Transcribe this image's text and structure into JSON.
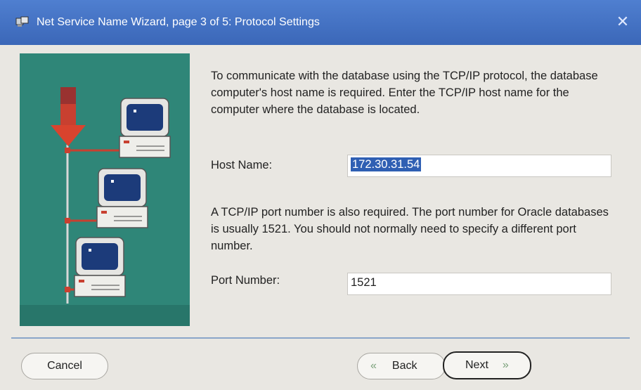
{
  "window": {
    "title": "Net Service Name Wizard, page 3 of 5: Protocol Settings",
    "close_glyph": "✕"
  },
  "content": {
    "intro": "To communicate with the database using the TCP/IP protocol, the database computer's host name is required.  Enter the TCP/IP host name for the computer where the database is located.",
    "host_label": "Host Name:",
    "host_value": "172.30.31.54",
    "port_intro": "A TCP/IP port number is also required.  The port number for Oracle databases is usually 1521.  You should not normally need to specify a different port number.",
    "port_label": "Port Number:",
    "port_value": "1521"
  },
  "buttons": {
    "cancel": "Cancel",
    "back": "Back",
    "next": "Next",
    "back_glyph": "«",
    "next_glyph": "»"
  },
  "colors": {
    "titlebar": "#3b67b8",
    "graphic_bg": "#2f8678",
    "selection": "#2f5fb3"
  },
  "icons": [
    "wizard-app-icon",
    "close-icon",
    "network-computer-icon",
    "arrow-down-icon",
    "chevron-left-icon",
    "chevron-right-icon"
  ]
}
